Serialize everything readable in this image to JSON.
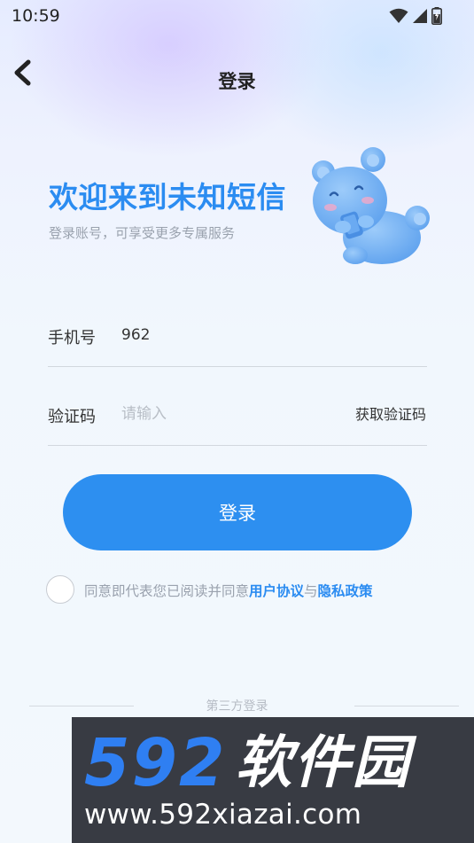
{
  "status_bar": {
    "time": "10:59"
  },
  "header": {
    "title": "登录"
  },
  "welcome": {
    "title": "欢迎来到未知短信",
    "subtitle": "登录账号，可享受更多专属服务"
  },
  "form": {
    "phone": {
      "label": "手机号",
      "value": "962"
    },
    "code": {
      "label": "验证码",
      "placeholder": "请输入",
      "get_code_label": "获取验证码"
    },
    "login_label": "登录"
  },
  "agreement": {
    "prefix": "同意即代表您已阅读并同意",
    "user_agreement": "用户协议",
    "conj": "与",
    "privacy_policy": "隐私政策"
  },
  "third_party": {
    "label": "第三方登录"
  },
  "watermark": {
    "brand_number": "592",
    "brand_name": "软件园",
    "url": "www.592xiazai.com"
  },
  "colors": {
    "accent": "#2d8ff0",
    "link": "#2b8cf1",
    "bear": "#7bb6f5"
  },
  "icons": [
    "back-arrow-icon",
    "wifi-icon",
    "signal-icon",
    "battery-icon",
    "bear-mascot"
  ]
}
